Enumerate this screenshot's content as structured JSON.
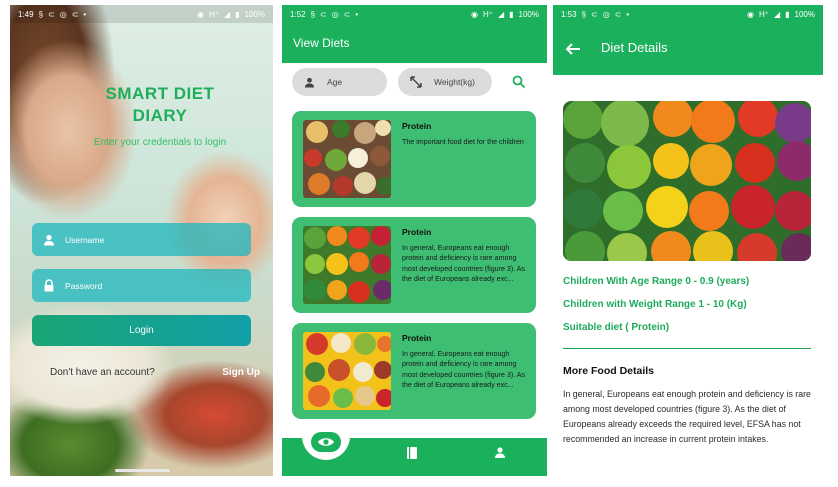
{
  "colors": {
    "brand_green": "#1bb05c",
    "card_green": "#3dbe72",
    "field_teal": "#18b5be",
    "accent_text": "#1faa5b"
  },
  "login_screen": {
    "status": {
      "time": "1:49",
      "network": "H⁺",
      "battery": "100%"
    },
    "title_line1": "SMART DIET",
    "title_line2": "DIARY",
    "subtitle": "Enter your credentials to login",
    "username": {
      "placeholder": "Username",
      "icon": "person-icon"
    },
    "password": {
      "placeholder": "Password",
      "icon": "lock-icon"
    },
    "login_label": "Login",
    "no_account_text": "Don't have an account?",
    "signup_label": "Sign Up"
  },
  "diets_screen": {
    "status": {
      "time": "1:52",
      "network": "H⁺",
      "battery": "100%"
    },
    "title": "View Diets",
    "filters": [
      {
        "label": "Age",
        "icon": "person-icon"
      },
      {
        "label": "Weight(kg)",
        "icon": "resize-icon"
      }
    ],
    "cards": [
      {
        "title": "Protein",
        "text": "The important food diet for the children"
      },
      {
        "title": "Protein",
        "text": "In general, Europeans eat enough protein and deficiency is rare among most developed countries (figure 3).  As the diet of Europeans already exc..."
      },
      {
        "title": "Protein",
        "text": "In general, Europeans eat enough protein and deficiency is rare among most developed countries (figure 3).  As the diet of Europeans already exc..."
      }
    ],
    "nav": [
      {
        "name": "eye-icon",
        "active": true
      },
      {
        "name": "book-icon",
        "active": false
      },
      {
        "name": "person-icon",
        "active": false
      }
    ]
  },
  "details_screen": {
    "status": {
      "time": "1:53",
      "network": "H⁺",
      "battery": "100%"
    },
    "title": "Diet Details",
    "age_range": "Children With Age Range  0 - 0.9 (years)",
    "weight_range": "Children with Weight Range  1 - 10 (Kg)",
    "suitable_diet": "Suitable diet ( Protein)",
    "more_title": "More Food Details",
    "more_body": "In general, Europeans eat enough protein and deficiency is rare among most developed countries (figure 3).  As the diet of Europeans already exceeds the required level, EFSA has not recommended an increase in current protein intakes."
  }
}
